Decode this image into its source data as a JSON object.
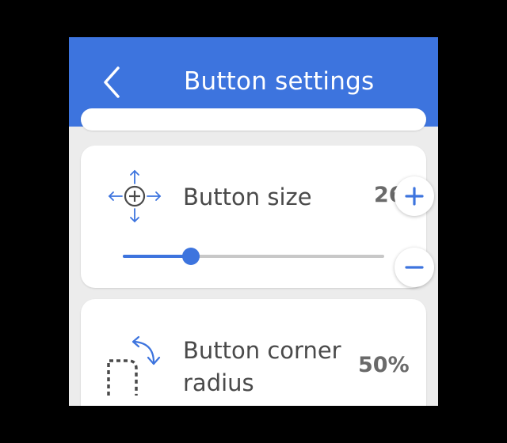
{
  "header": {
    "title": "Button settings",
    "back_icon": "chevron-left-icon",
    "background_color": "#3d74de"
  },
  "settings": {
    "button_size": {
      "label": "Button size",
      "value": "26",
      "icon": "move-crosshair-icon",
      "increase_icon": "plus-icon",
      "decrease_icon": "minus-icon",
      "slider_level": 0.26
    },
    "corner_radius": {
      "label_line1": "Button corner",
      "label_line2": "radius",
      "value": "50%",
      "icon": "corner-radius-icon"
    }
  },
  "colors": {
    "accent": "#3d74de",
    "background": "#ececec",
    "card": "#ffffff"
  }
}
